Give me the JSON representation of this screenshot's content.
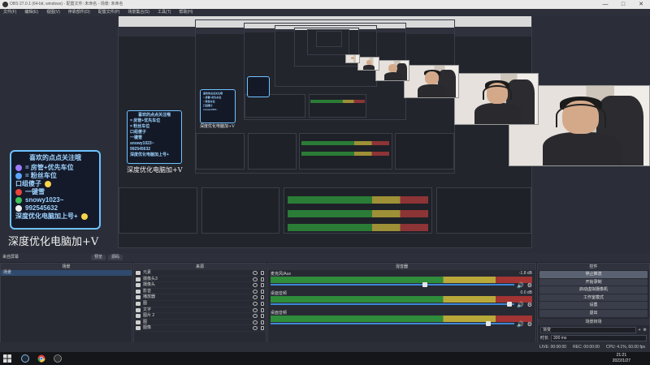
{
  "window": {
    "title": "OBS 27.0.1 (64-bit, windows) - 配置文件: 未命名 - 场景: 未命名"
  },
  "menu": [
    "文件(F)",
    "编辑(E)",
    "视图(V)",
    "停靠部件(D)",
    "配置文件(P)",
    "场景集合(S)",
    "工具(T)",
    "帮助(H)"
  ],
  "overlay": {
    "sticker_title": "喜欢的点点关注哦",
    "lines": [
      "= 房管+优先车位",
      "= 粉丝车位",
      "口组傻子",
      "一键雪",
      "snowy1023~",
      "992545632",
      "深度优化电脑加上号+"
    ],
    "big_caption": "深度优化电脑加+V"
  },
  "dock": {
    "bar_label": "来自屏幕",
    "tabs": [
      "预览",
      "源码"
    ],
    "scenes_header": "场景",
    "scene_items": [
      "场景"
    ],
    "sources_header": "来源",
    "sources": [
      "元素",
      "摄像头3",
      "摄像头",
      "影音",
      "播放器",
      "图",
      "文字",
      "图片 2",
      "图",
      "图像"
    ],
    "mixer_header": "混音器",
    "channels": [
      {
        "name": "麦克风/Aux",
        "value": "-1.8 dB"
      },
      {
        "name": "桌面音频",
        "value": "0.0 dB"
      },
      {
        "name": "桌面音频",
        "value": ""
      }
    ],
    "controls_header": "控件",
    "controls": [
      "停止推流",
      "开始录制",
      "启动虚拟摄像机",
      "工作室模式",
      "设置",
      "退出"
    ],
    "transitions_header": "场景转场",
    "transition_value": "渐变",
    "duration_label": "时长",
    "duration_value": "300 ms",
    "footer_icons": [
      "+",
      "−",
      "∧",
      "∨"
    ]
  },
  "status": {
    "live": "LIVE: 00:00:00",
    "rec": "REC: 00:00:00",
    "cpu": "CPU: 4.1%, 60.00 fps"
  },
  "taskbar": {
    "time": "21:21",
    "date": "2022/1/27"
  },
  "colors": {
    "accent": "#3e86d6",
    "panel": "#272a33",
    "sticker_border": "#6ec3ff"
  }
}
